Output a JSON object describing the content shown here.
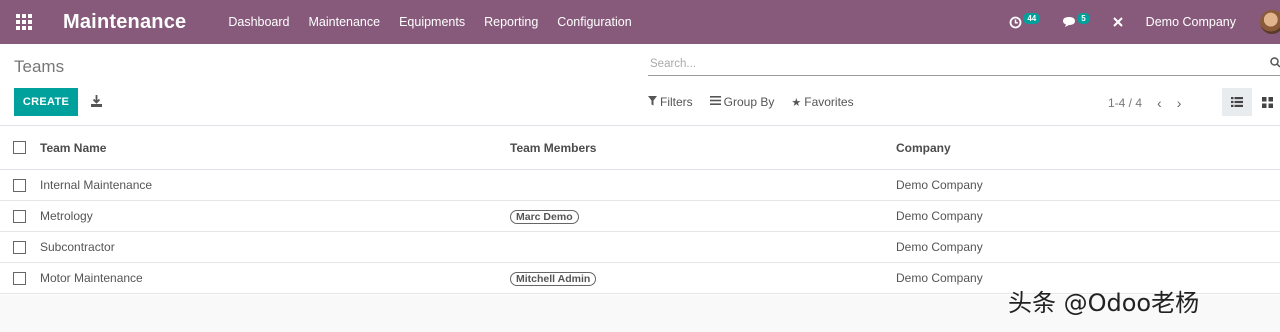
{
  "navbar": {
    "app_title": "Maintenance",
    "menu": [
      "Dashboard",
      "Maintenance",
      "Equipments",
      "Reporting",
      "Configuration"
    ],
    "activity_badge": "44",
    "messages_badge": "5",
    "company": "Demo Company"
  },
  "control": {
    "breadcrumb": "Teams",
    "search_placeholder": "Search...",
    "create_label": "CREATE",
    "filters_label": "Filters",
    "group_by_label": "Group By",
    "favorites_label": "Favorites",
    "pager": "1-4 / 4"
  },
  "table": {
    "columns": [
      "Team Name",
      "Team Members",
      "Company"
    ],
    "rows": [
      {
        "name": "Internal Maintenance",
        "members": "",
        "company": "Demo Company"
      },
      {
        "name": "Metrology",
        "members": "Marc Demo",
        "company": "Demo Company"
      },
      {
        "name": "Subcontractor",
        "members": "",
        "company": "Demo Company"
      },
      {
        "name": "Motor Maintenance",
        "members": "Mitchell Admin",
        "company": "Demo Company"
      }
    ]
  },
  "watermark": "头条 @Odoo老杨",
  "colors": {
    "navbar": "#875a7b",
    "accent": "#00a09d"
  }
}
